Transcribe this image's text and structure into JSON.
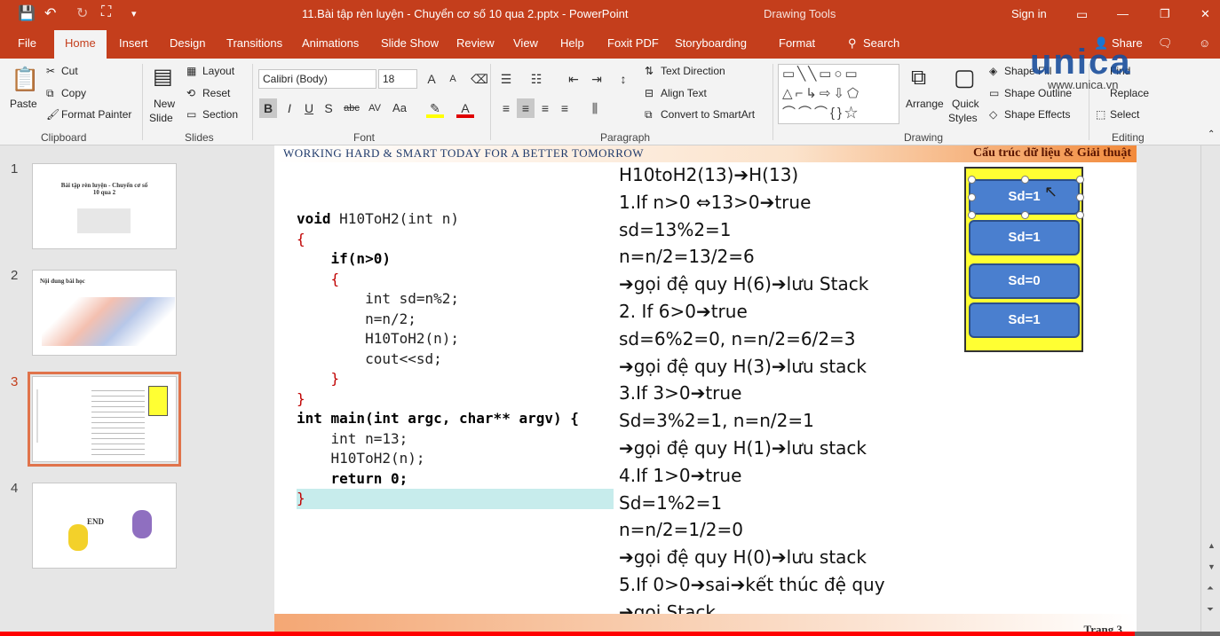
{
  "window": {
    "title": "11.Bài tập rèn luyện - Chuyển cơ số 10 qua 2.pptx - PowerPoint",
    "contextual": "Drawing Tools",
    "signin": "Sign in",
    "search": "Search",
    "share": "Share"
  },
  "tabs": [
    "File",
    "Home",
    "Insert",
    "Design",
    "Transitions",
    "Animations",
    "Slide Show",
    "Review",
    "View",
    "Help",
    "Foxit PDF",
    "Storyboarding",
    "Format"
  ],
  "ribbon": {
    "clipboard": {
      "paste": "Paste",
      "cut": "Cut",
      "copy": "Copy",
      "painter": "Format Painter",
      "label": "Clipboard"
    },
    "slides": {
      "new": "New",
      "slide": "Slide",
      "layout": "Layout",
      "reset": "Reset",
      "section": "Section",
      "label": "Slides"
    },
    "font": {
      "name": "Calibri (Body)",
      "size": "18",
      "label": "Font",
      "bold": "B",
      "italic": "I",
      "underline": "U",
      "shadow": "S",
      "strike": "abc",
      "spacing": "AV",
      "case": "Aa",
      "color": "A"
    },
    "paragraph": {
      "text_direction": "Text Direction",
      "align_text": "Align Text",
      "smartart": "Convert to SmartArt",
      "label": "Paragraph"
    },
    "drawing": {
      "arrange": "Arrange",
      "quick": "Quick",
      "styles": "Styles",
      "fill": "Shape Fill",
      "outline": "Shape Outline",
      "effects": "Shape Effects",
      "label": "Drawing"
    },
    "editing": {
      "find": "Find",
      "replace": "Replace",
      "select": "Select",
      "label": "Editing"
    }
  },
  "watermark": {
    "brand": "unica",
    "url": "www.unica.vn"
  },
  "thumbnails": [
    {
      "n": "1",
      "title": "Bài tập rèn luyện - Chuyển cơ số 10 qua 2"
    },
    {
      "n": "2",
      "title": "Nội dung bài học"
    },
    {
      "n": "3",
      "title": ""
    },
    {
      "n": "4",
      "title": "END"
    }
  ],
  "slide": {
    "motto": "WORKING HARD & SMART TODAY FOR A BETTER TOMORROW",
    "subject": "Cấu trúc dữ liệu & Giải thuật",
    "page": "Trang 3",
    "code": [
      "void H10ToH2(int n)",
      "{",
      "    if(n>0)",
      "    {",
      "        int sd=n%2;",
      "        n=n/2;",
      "        H10ToH2(n);",
      "        cout<<sd;",
      "    }",
      "}",
      "int main(int argc, char** argv) {",
      "    int n=13;",
      "    H10ToH2(n);",
      "    return 0;",
      "}"
    ],
    "steps": [
      "H10toH2(13)➔H(13)",
      "1.If n>0 ⇔13>0➔true",
      "sd=13%2=1",
      "n=n/2=13/2=6",
      "➔gọi đệ quy H(6)➔lưu Stack",
      "2. If 6>0➔true",
      "sd=6%2=0, n=n/2=6/2=3",
      "➔gọi đệ quy H(3)➔lưu stack",
      "3.If 3>0➔true",
      "Sd=3%2=1, n=n/2=1",
      "➔gọi đệ quy H(1)➔lưu stack",
      "4.If 1>0➔true",
      "Sd=1%2=1",
      "n=n/2=1/2=0",
      "➔gọi đệ quy H(0)➔lưu stack",
      "5.If 0>0➔sai➔kết thúc đệ quy",
      "➔gọi Stack"
    ],
    "stack": [
      "Sd=1",
      "Sd=1",
      "Sd=0",
      "Sd=1"
    ]
  },
  "video": {
    "progress": 0.93
  },
  "colors": {
    "accent": "#c43e1c",
    "stack_bg": "#ffff33",
    "stack_box": "#4a7fcf"
  }
}
